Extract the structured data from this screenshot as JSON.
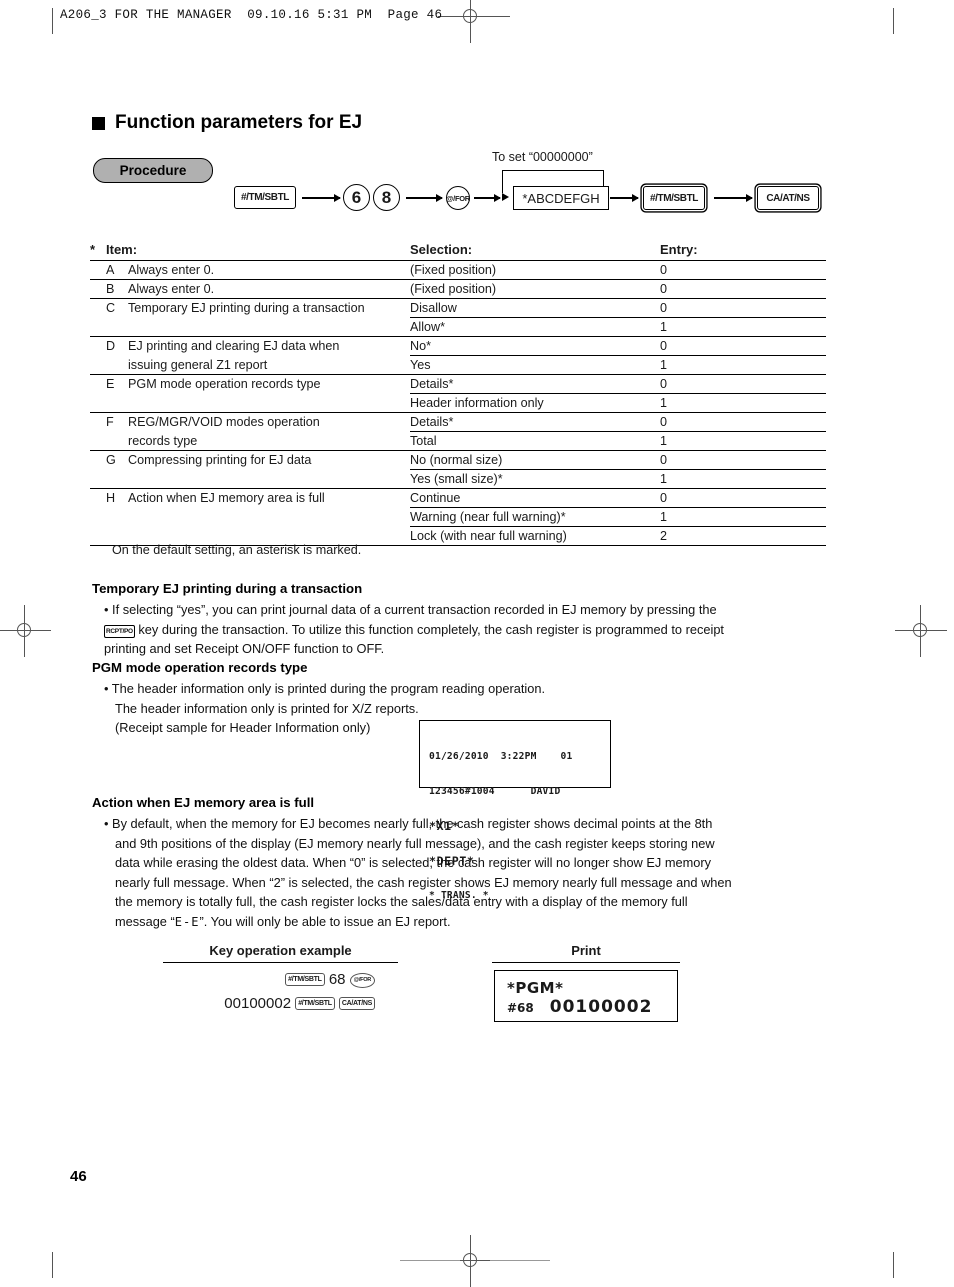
{
  "page_header": "A206_3 FOR THE MANAGER  09.10.16 5:31 PM  Page 46",
  "page_number": "46",
  "section": {
    "title": "Function parameters for EJ",
    "procedure_badge": "Procedure"
  },
  "flow": {
    "key1": "#/TM/SBTL",
    "digit1": "6",
    "digit2": "8",
    "key_for": "@/FOR",
    "loop_label": "To set “00000000”",
    "value_box": "*ABCDEFGH",
    "key2": "#/TM/SBTL",
    "key3": "CA/AT/NS"
  },
  "table": {
    "headers": {
      "star": "*",
      "item": "Item:",
      "selection": "Selection:",
      "entry": "Entry:"
    },
    "rows": [
      {
        "letter": "A",
        "desc": [
          "Always enter 0."
        ],
        "options": [
          {
            "selection": "(Fixed position)",
            "entry": "0"
          }
        ]
      },
      {
        "letter": "B",
        "desc": [
          "Always enter 0."
        ],
        "options": [
          {
            "selection": "(Fixed position)",
            "entry": "0"
          }
        ]
      },
      {
        "letter": "C",
        "desc": [
          "Temporary EJ printing during a transaction"
        ],
        "options": [
          {
            "selection": "Disallow",
            "entry": "0"
          },
          {
            "selection": "Allow*",
            "entry": "1"
          }
        ]
      },
      {
        "letter": "D",
        "desc": [
          "EJ printing and clearing EJ data when",
          "issuing general Z1 report"
        ],
        "options": [
          {
            "selection": "No*",
            "entry": "0"
          },
          {
            "selection": "Yes",
            "entry": "1"
          }
        ]
      },
      {
        "letter": "E",
        "desc": [
          "PGM mode operation records type"
        ],
        "options": [
          {
            "selection": "Details*",
            "entry": "0"
          },
          {
            "selection": "Header information only",
            "entry": "1"
          }
        ]
      },
      {
        "letter": "F",
        "desc": [
          "REG/MGR/VOID modes operation",
          "records type"
        ],
        "options": [
          {
            "selection": "Details*",
            "entry": "0"
          },
          {
            "selection": "Total",
            "entry": "1"
          }
        ]
      },
      {
        "letter": "G",
        "desc": [
          "Compressing printing for EJ data"
        ],
        "options": [
          {
            "selection": "No (normal size)",
            "entry": "0"
          },
          {
            "selection": "Yes (small size)*",
            "entry": "1"
          }
        ]
      },
      {
        "letter": "H",
        "desc": [
          "Action when EJ memory area is full"
        ],
        "options": [
          {
            "selection": "Continue",
            "entry": "0"
          },
          {
            "selection": "Warning (near full warning)*",
            "entry": "1"
          },
          {
            "selection": "Lock (with near full warning)",
            "entry": "2"
          }
        ]
      }
    ],
    "footnote": "On the default setting, an asterisk is marked."
  },
  "sections": {
    "temp_ej": {
      "heading": "Temporary EJ printing during a transaction",
      "line1_a": "• If selecting “yes”, you can print journal data of a current transaction recorded in EJ memory by pressing the",
      "key_label": "RCPT/PO",
      "line2_b": "key during the transaction.  To utilize this function completely, the cash register is programmed to receipt",
      "line3": "printing and set Receipt ON/OFF function to OFF."
    },
    "pgm_mode": {
      "heading": "PGM mode operation records type",
      "line1": "• The header information only is printed during the program reading operation.",
      "line2": "The header information only is printed for X/Z reports.",
      "line3": "(Receipt sample for Header Information only)"
    },
    "receipt_sample": {
      "line1": "01/26/2010  3:22PM    01",
      "line2": "123456#1004      DAVID",
      "line3": "*X1*",
      "line4": "*DEPT*",
      "line5": "* TRANS. *"
    },
    "memory_full": {
      "heading": "Action when EJ memory area is full",
      "line1": "• By default, when the memory for EJ becomes nearly full, the cash register shows decimal points at the 8th",
      "line2": "and 9th positions of the display (EJ memory nearly full message), and the cash register keeps storing new",
      "line3": "data while erasing the oldest data.  When “0” is selected, the cash register will no longer show EJ memory",
      "line4": "nearly full message.  When “2” is selected, the cash register shows EJ memory nearly full message and when",
      "line5": "the memory is totally full, the cash register locks the sales/data entry with a display of the memory full",
      "line6_a": "message “",
      "line6_seg": "E-E",
      "line6_b": "”.  You will only be able to issue an EJ report."
    }
  },
  "example": {
    "key_ops_heading": "Key operation example",
    "print_heading": "Print",
    "ops_line1_key1": "#/TM/SBTL",
    "ops_line1_num": "68",
    "ops_line1_key2": "@/FOR",
    "ops_line2_num": "00100002",
    "ops_line2_key1": "#/TM/SBTL",
    "ops_line2_key2": "CA/AT/NS",
    "print_line1": "*PGM*",
    "print_line2_label": "#68",
    "print_line2_value": "00100002"
  }
}
